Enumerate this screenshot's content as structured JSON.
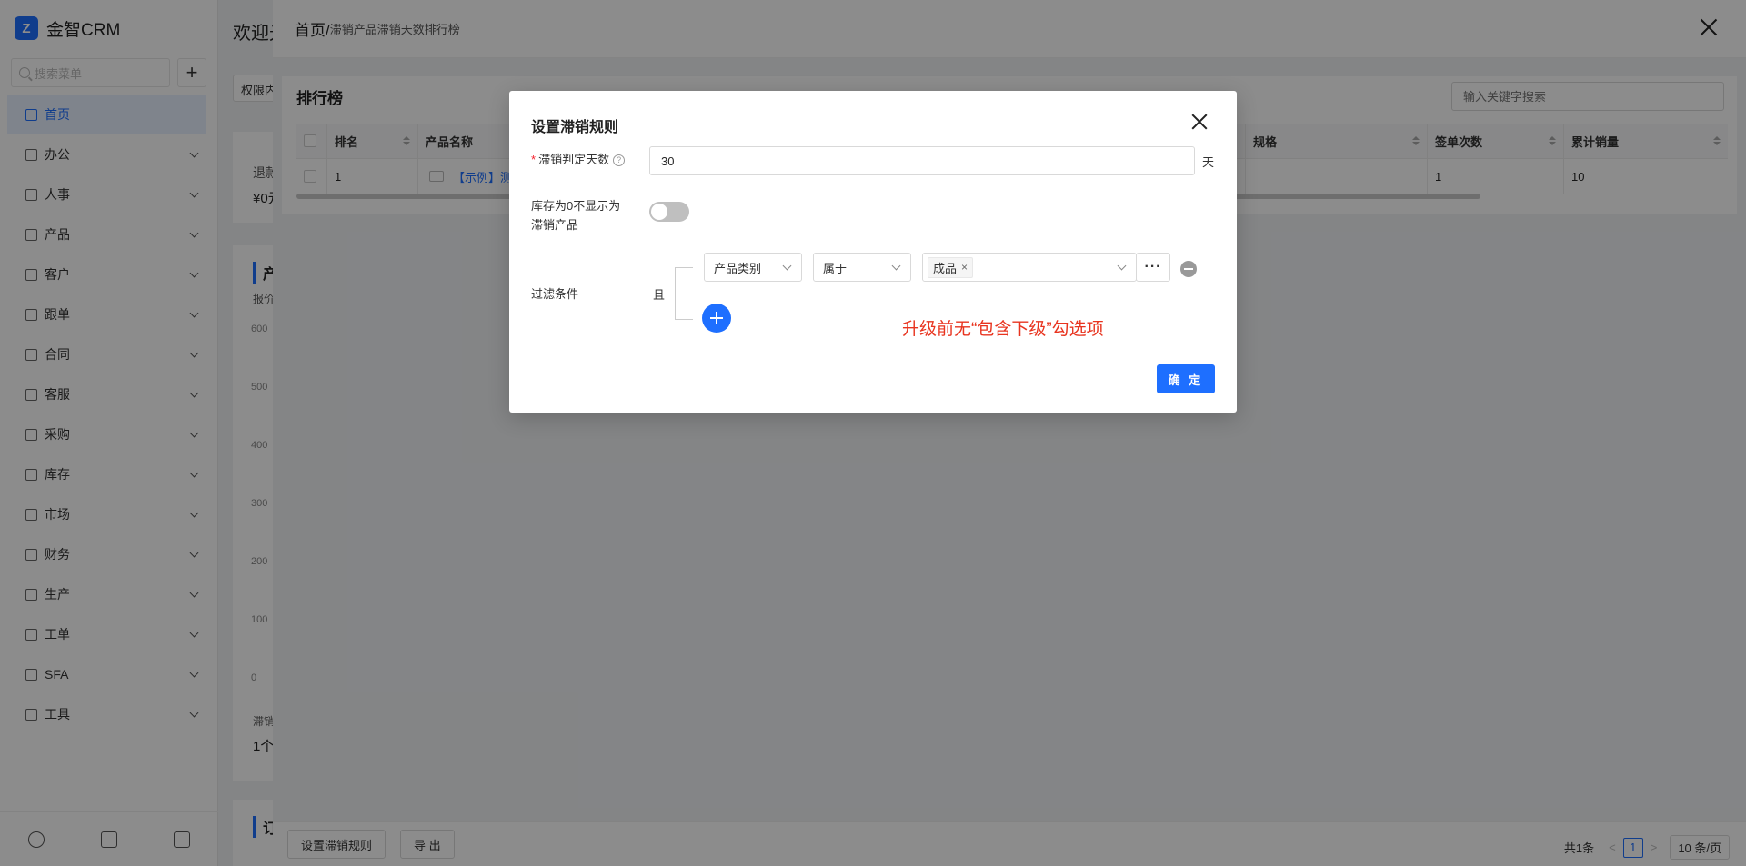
{
  "app": {
    "brand_logo": "Z",
    "brand_name": "金智CRM"
  },
  "sidebar": {
    "search_placeholder": "搜索菜单",
    "add_label": "+",
    "items": [
      {
        "label": "首页",
        "icon": "home-icon",
        "active": true,
        "expandable": false
      },
      {
        "label": "办公",
        "icon": "office-icon",
        "expandable": true
      },
      {
        "label": "人事",
        "icon": "people-icon",
        "expandable": true
      },
      {
        "label": "产品",
        "icon": "product-icon",
        "expandable": true
      },
      {
        "label": "客户",
        "icon": "customer-icon",
        "expandable": true
      },
      {
        "label": "跟单",
        "icon": "follow-icon",
        "expandable": true
      },
      {
        "label": "合同",
        "icon": "contract-icon",
        "expandable": true
      },
      {
        "label": "客服",
        "icon": "service-icon",
        "expandable": true
      },
      {
        "label": "采购",
        "icon": "purchase-icon",
        "expandable": true
      },
      {
        "label": "库存",
        "icon": "inventory-icon",
        "expandable": true
      },
      {
        "label": "市场",
        "icon": "market-icon",
        "expandable": true
      },
      {
        "label": "财务",
        "icon": "finance-icon",
        "expandable": true
      },
      {
        "label": "生产",
        "icon": "production-icon",
        "expandable": true
      },
      {
        "label": "工单",
        "icon": "workorder-icon",
        "expandable": true
      },
      {
        "label": "SFA",
        "icon": "sfa-icon",
        "expandable": true
      },
      {
        "label": "工具",
        "icon": "tools-icon",
        "expandable": true
      }
    ],
    "bottom_tools": [
      "history-icon",
      "settings-sliders-icon",
      "collapse-menu-icon"
    ]
  },
  "dashboard": {
    "welcome": "欢迎光临",
    "perm_button": "权限内",
    "card1_title": "退款",
    "card1_value": "¥0元",
    "card2_title": "产品",
    "card2_sub": "报价产",
    "axis_ticks": [
      "600",
      "500",
      "400",
      "300",
      "200",
      "100",
      "0"
    ],
    "card2_footer_title": "滞销",
    "card2_footer_value": "1个",
    "card3_title": "订单"
  },
  "drawer": {
    "breadcrumb_home": "首页/",
    "breadcrumb_current": "滞销产品滞销天数排行榜",
    "panel_title": "排行榜",
    "search_placeholder": "输入关键字搜索",
    "table": {
      "columns": [
        "排名",
        "产品名称",
        "规格",
        "签单次数",
        "累计销量"
      ],
      "rows": [
        {
          "rank": "1",
          "name": "【示例】测",
          "spec": "",
          "sign_count": "1",
          "total_sales": "10"
        }
      ]
    },
    "footer": {
      "set_rule_button": "设置滞销规则",
      "export_button": "导 出",
      "total": "共1条",
      "current_page": "1",
      "prev": "<",
      "next": ">",
      "page_size": "10 条/页"
    }
  },
  "modal": {
    "title": "设置滞销规则",
    "days_label": "滞销判定天数",
    "days_help": "?",
    "days_value": "30",
    "days_unit": "天",
    "zero_stock_label_line1": "库存为0不显示为",
    "zero_stock_label_line2": "滞销产品",
    "zero_stock_toggle": false,
    "filter_label": "过滤条件",
    "filter_logic": "且",
    "condition": {
      "field": "产品类别",
      "operator": "属于",
      "value_tag": "成品",
      "more": "···"
    },
    "annotation": "升级前无“包含下级”勾选项",
    "confirm_button": "确 定"
  },
  "colors": {
    "accent": "#1e6fff",
    "annotation": "#e8341f",
    "mask": "rgba(0,0,0,0.45)"
  }
}
